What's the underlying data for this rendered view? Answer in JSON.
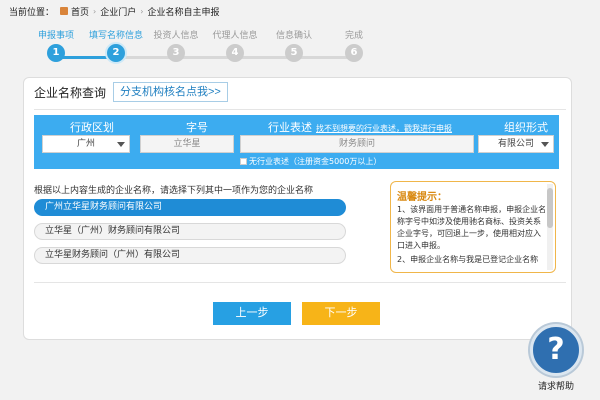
{
  "breadcrumb": {
    "label": "当前位置：",
    "items": [
      "首页",
      "企业门户",
      "企业名称自主申报"
    ]
  },
  "steps": [
    {
      "label": "申报事项",
      "num": "1"
    },
    {
      "label": "填写名称信息",
      "num": "2"
    },
    {
      "label": "投资人信息",
      "num": "3"
    },
    {
      "label": "代理人信息",
      "num": "4"
    },
    {
      "label": "信息确认",
      "num": "5"
    },
    {
      "label": "完成",
      "num": "6"
    }
  ],
  "panel": {
    "title": "企业名称查询",
    "branch_button": "分支机构核名点我>>"
  },
  "query": {
    "region_header": "行政区划",
    "region_value": "广州",
    "zihao_header": "字号",
    "zihao_value": "立华星",
    "industry_header": "行业表述",
    "industry_link": "找不到想要的行业表述，戳我进行申报",
    "industry_value": "财务顾问",
    "form_header": "组织形式",
    "form_value": "有限公司",
    "no_industry_label": "无行业表述（注册资金5000万以上）"
  },
  "instruction": "根据以上内容生成的企业名称，请选择下列其中一项作为您的企业名称",
  "name_options": [
    "广州立华星财务顾问有限公司",
    "立华星（广州）财务顾问有限公司",
    "立华星财务顾问（广州）有限公司"
  ],
  "tip": {
    "title": "温馨提示：",
    "line1": "1、该界面用于普通名称申报，申报企业名称字号中如涉及使用驰名商标、投资关系企业字号，可回退上一步，使用相对应入口进入申报。",
    "line2": "2、申报企业名称与我是已登记企业名称"
  },
  "buttons": {
    "prev": "上一步",
    "next": "下一步"
  },
  "help": {
    "label": "请求帮助",
    "glyph": "?"
  },
  "colors": {
    "accent": "#2ea0dc",
    "query_bar": "#3cacf0",
    "selected_option": "#1f8cd6",
    "next_button": "#f7b418",
    "tip_border": "#f0b64a"
  }
}
